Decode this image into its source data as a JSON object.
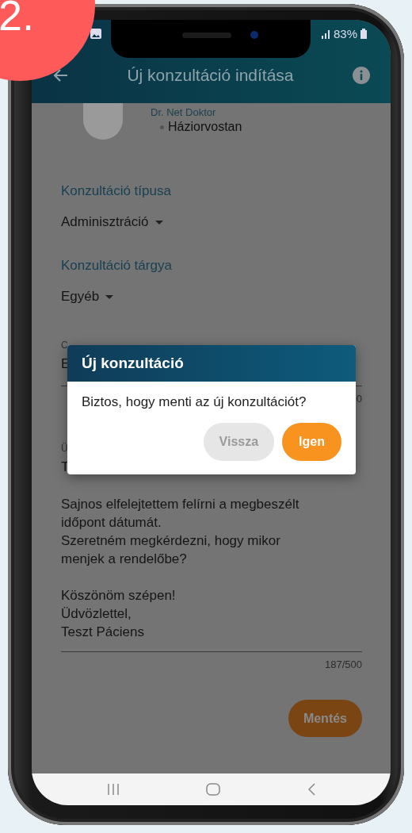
{
  "step_badge": "2.",
  "status_bar": {
    "battery": "83%"
  },
  "app_bar": {
    "title": "Új konzultáció indítása"
  },
  "doctor": {
    "name": "Dr. Net Doktor",
    "specialty": "Háziorvostan"
  },
  "selects": [
    {
      "label": "Konzultáció típusa",
      "value": "Adminisztráció"
    },
    {
      "label": "Konzultáció tárgya",
      "value": "Egyéb"
    }
  ],
  "subject_field": {
    "label": "C",
    "value": "E",
    "counter": "0"
  },
  "message_field": {
    "label": "Ü",
    "value": "T",
    "text": "Sajnos elfelejtettem felírni a megbeszélt\nidőpont dátumát.\nSzeretném megkérdezni, hogy mikor\nmenjek a rendelőbe?\n\nKöszönöm szépen!\nÜdvözlettel,\nTeszt Páciens",
    "counter": "187/500"
  },
  "save_button": "Mentés",
  "dialog": {
    "title": "Új konzultáció",
    "message": "Biztos, hogy menti az új konzultációt?",
    "buttons": [
      {
        "label": "Vissza",
        "kind": "secondary"
      },
      {
        "label": "Igen",
        "kind": "primary"
      }
    ]
  }
}
